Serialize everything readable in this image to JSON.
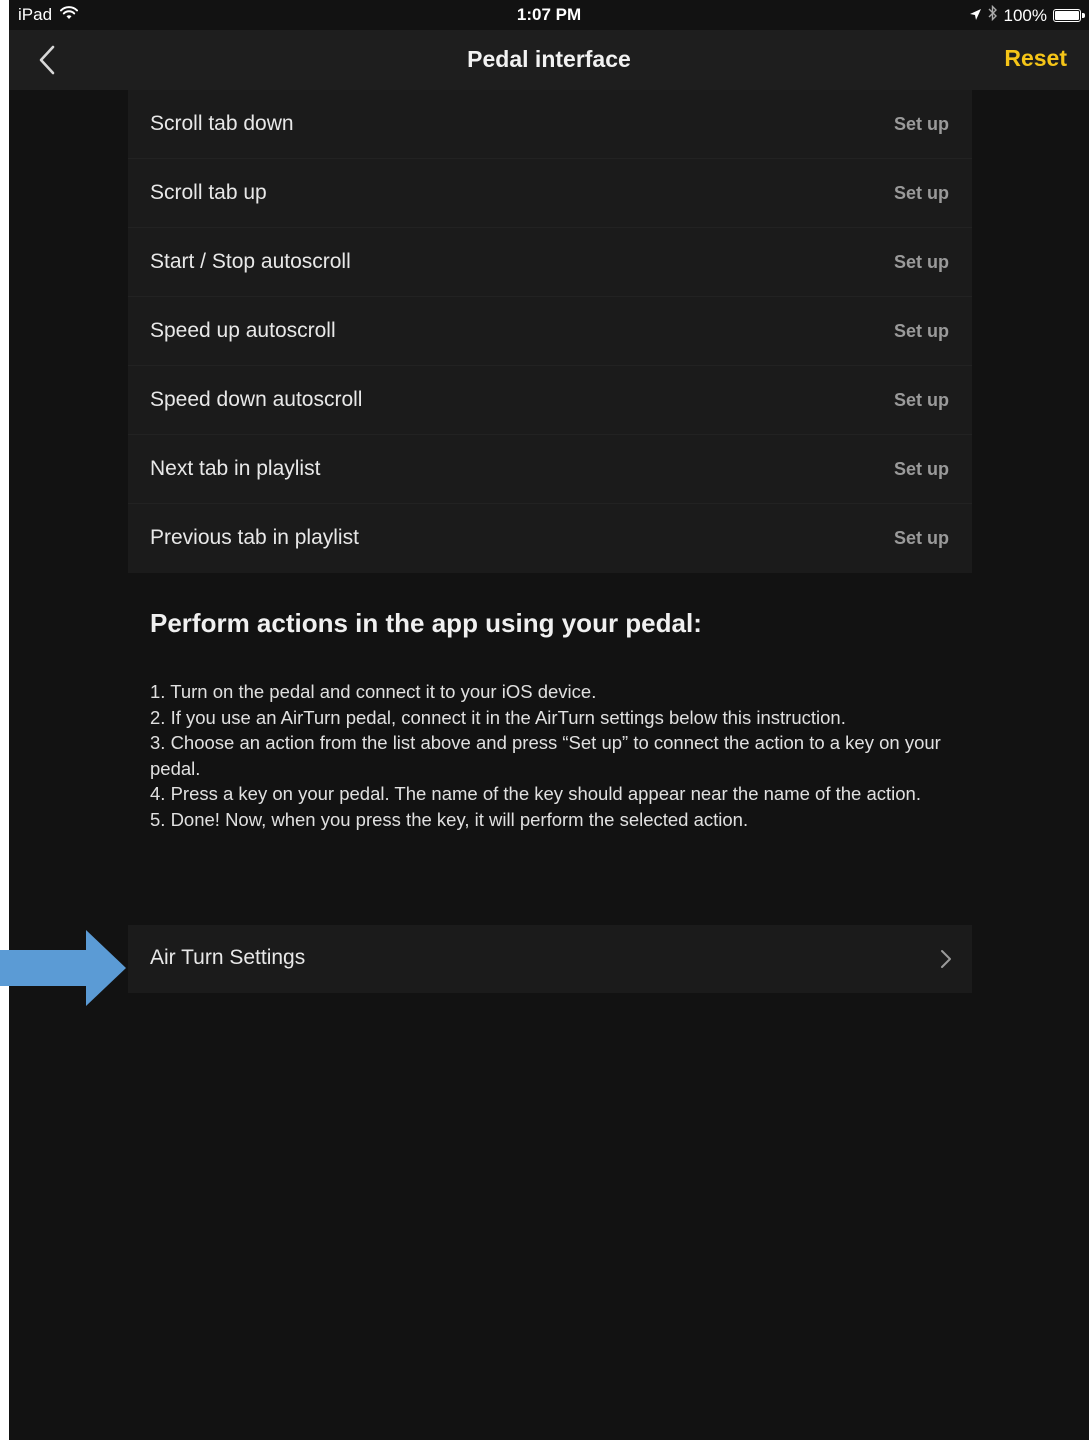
{
  "status_bar": {
    "device": "iPad",
    "time": "1:07 PM",
    "battery": "100%",
    "battery_level": 1.0
  },
  "nav": {
    "title": "Pedal interface",
    "reset_label": "Reset",
    "back_icon": "chevron-left-icon"
  },
  "actions": [
    {
      "label": "Scroll tab down",
      "action": "Set up"
    },
    {
      "label": "Scroll tab up",
      "action": "Set up"
    },
    {
      "label": "Start / Stop autoscroll",
      "action": "Set up"
    },
    {
      "label": "Speed up autoscroll",
      "action": "Set up"
    },
    {
      "label": "Speed down autoscroll",
      "action": "Set up"
    },
    {
      "label": "Next tab in playlist",
      "action": "Set up"
    },
    {
      "label": "Previous tab in playlist",
      "action": "Set up"
    }
  ],
  "instructions": {
    "heading": "Perform actions in the app using your pedal:",
    "steps": [
      "1. Turn on the pedal and connect it to your iOS device.",
      "2. If you use an AirTurn pedal, connect it in the AirTurn settings below this instruction.",
      "3. Choose an action from the list above and press “Set up” to connect the action to a key on your pedal.",
      "4. Press a key on your pedal. The name of the key should appear near the name of the action.",
      "5. Done! Now, when you press the key, it will perform the selected action."
    ]
  },
  "airturn": {
    "label": "Air Turn Settings",
    "icon": "chevron-right-icon"
  },
  "colors": {
    "accent": "#f5c518",
    "background": "#121212",
    "row_background": "#1b1b1b",
    "nav_background": "#1e1e1e",
    "annotation_arrow": "#5b9bd5"
  }
}
